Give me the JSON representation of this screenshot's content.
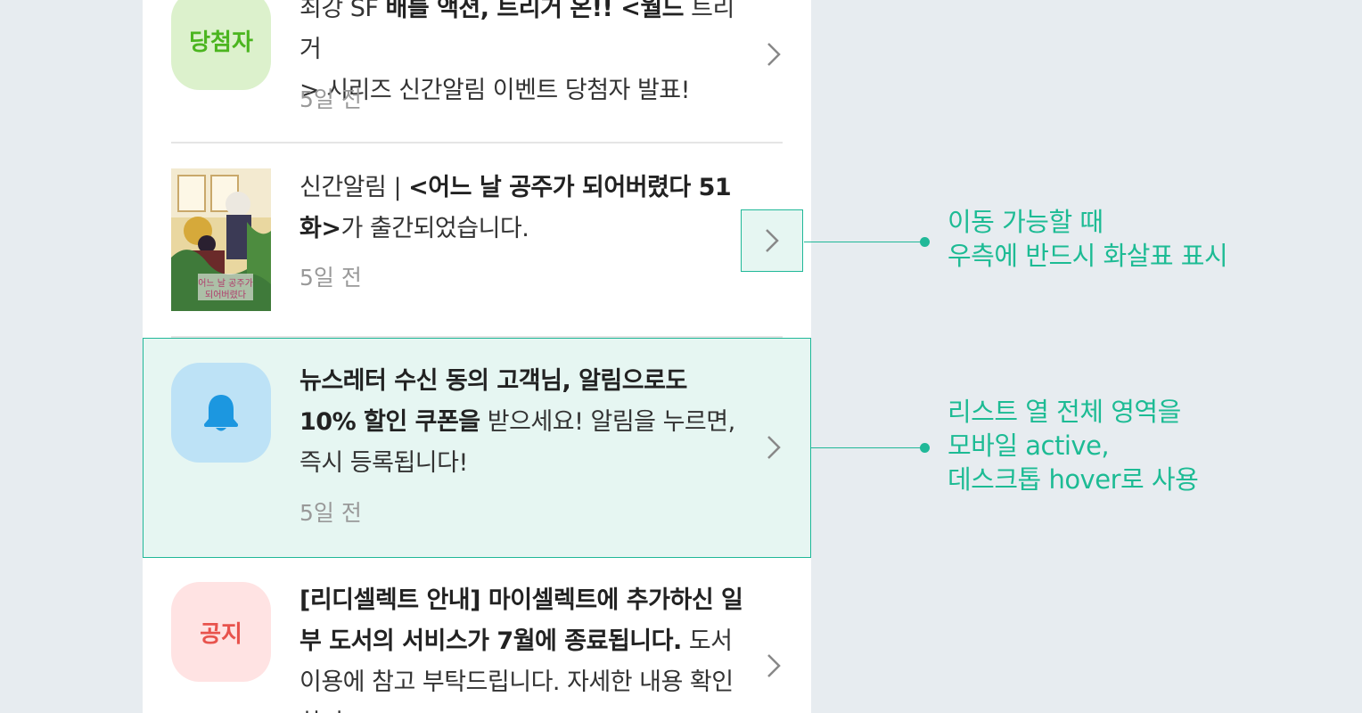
{
  "list": {
    "items": [
      {
        "badge": "당첨자",
        "text_line1_normal": "최강 SF ",
        "text_line1_bold": "배틀 액션, 트리거 온!! <월드",
        "text_line1_tail": " 트리거",
        "text_line2": "> 시리즈 신간알림 이벤트 당첨자 발표!",
        "time": "5일 전"
      },
      {
        "cover_title": "어느 날 공주가 되어버렸다",
        "text_prefix": "신간알림 | ",
        "text_bold": "<어느 날 공주가 되어버렸다 51 화>",
        "text_tail": "가 출간되었습니다.",
        "time": "5일 전"
      },
      {
        "icon": "bell-icon",
        "text_bold": "뉴스레터 수신 동의 고객님, 알림으로도 10% 할인 쿠폰을",
        "text_tail": " 받으세요! 알림을 누르면, 즉시 등록됩니다!",
        "time": "5일 전"
      },
      {
        "badge": "공지",
        "text_bold": "[리디셀렉트 안내] 마이셀렉트에 추가하신 일부 도서의 서비스가 7월에 종료됩니다.",
        "text_tail": " 도서 이용에 참고 부탁드립니다. 자세한 내용 확인하기"
      }
    ]
  },
  "annotations": {
    "arrow_note_line1": "이동 가능할 때",
    "arrow_note_line2": "우측에 반드시 화살표 표시",
    "row_note_line1": "리스트 열 전체 영역을",
    "row_note_line2": "모바일 active,",
    "row_note_line3": "데스크톱 hover로 사용"
  },
  "colors": {
    "accent": "#1dbb94",
    "winner_badge_bg": "#dcf1cc",
    "winner_badge_text": "#4bb51f",
    "bell_badge_bg": "#bde2f6",
    "bell_icon": "#1c97e0",
    "notice_badge_bg": "#ffe3e3",
    "notice_badge_text": "#e8534d",
    "active_row_bg": "#e6f6f2"
  }
}
